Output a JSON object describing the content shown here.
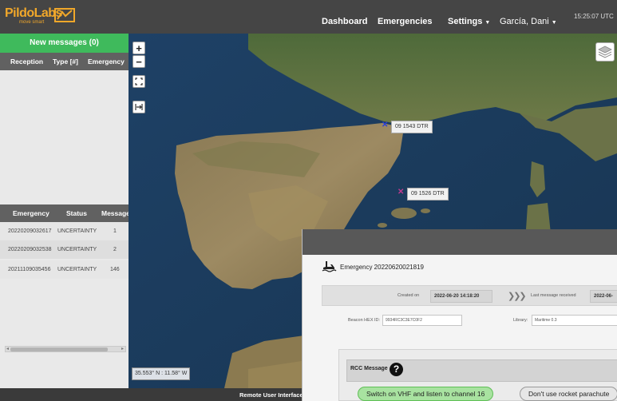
{
  "navbar": {
    "logo_text": "PildoLabs",
    "logo_tagline": "move smart",
    "dashboard": "Dashboard",
    "emergencies": "Emergencies",
    "settings": "Settings",
    "user": "García, Dani",
    "time": "15:25:07 UTC"
  },
  "sidebar": {
    "new_messages": "New messages (0)",
    "messages_headers": [
      "Reception",
      "Type [#]",
      "Emergency"
    ],
    "emergency_headers": [
      "Emergency",
      "Status",
      "Messages"
    ],
    "emergencies": [
      {
        "id": "20220209032617",
        "status": "UNCERTAINTY",
        "messages": "1"
      },
      {
        "id": "20220209032538",
        "status": "UNCERTAINTY",
        "messages": "2"
      },
      {
        "id": "20211109035456",
        "status": "UNCERTAINTY",
        "messages": "146"
      }
    ]
  },
  "map": {
    "zoom_in": "+",
    "zoom_out": "−",
    "markers": [
      {
        "label": "09 1543 DTR",
        "color": "#2a3fd6"
      },
      {
        "label": "09 1526 DTR",
        "color": "#c03a8f"
      }
    ],
    "coordinates": "35.553° N : 11.58° W"
  },
  "footer": {
    "remote_ui": "Remote User Interface"
  },
  "emergency_panel": {
    "title": "Emergency 20220620021819",
    "created_on_label": "Created on",
    "created_on_value": "2022-06-20 14:18:20",
    "last_message_label": "Last message received",
    "last_message_value": "2022-06-",
    "beacon_label": "Beacon HEX ID:",
    "beacon_value": "9934RC3C3E7C0F2",
    "library_label": "Library:",
    "library_value": "Maritime 0.3",
    "rcc_label": "RCC Message",
    "action_primary": "Switch on VHF and listen to channel 16",
    "action_secondary": "Don't use rocket parachute"
  }
}
